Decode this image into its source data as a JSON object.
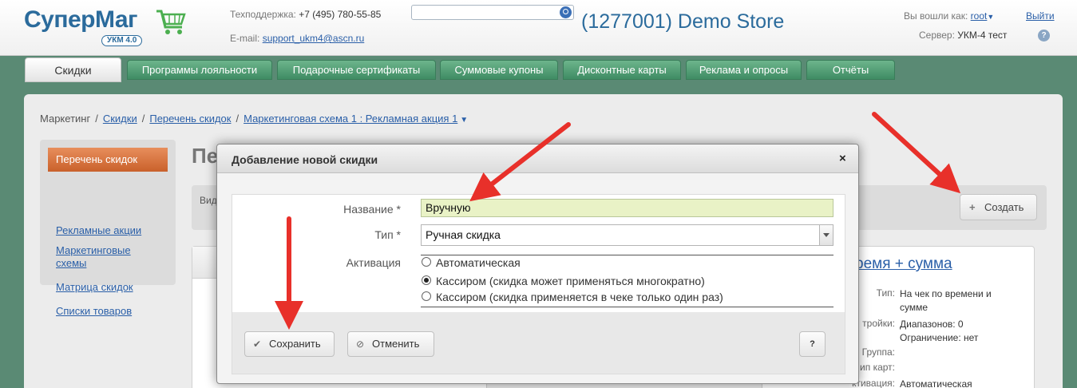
{
  "header": {
    "logo_text": "СуперМаг",
    "logo_badge": "УКМ 4.0",
    "support_label": "Техподдержка:",
    "support_phone": "+7 (495) 780-55-85",
    "email_label": "E-mail:",
    "email": "support_ukm4@ascn.ru",
    "search_placeholder": "",
    "store": "(1277001) Demo Store",
    "login_label": "Вы вошли как:",
    "login_user": "root",
    "logout": "Выйти",
    "server_label": "Сервер:",
    "server_value": "УКМ-4 тест",
    "help": "?"
  },
  "tabs": [
    {
      "label": "Скидки",
      "active": true
    },
    {
      "label": "Программы лояльности"
    },
    {
      "label": "Подарочные сертификаты"
    },
    {
      "label": "Суммовые купоны"
    },
    {
      "label": "Дисконтные карты"
    },
    {
      "label": "Реклама и опросы"
    },
    {
      "label": "Отчёты"
    }
  ],
  "breadcrumb": {
    "root": "Маркетинг",
    "items": [
      "Скидки",
      "Перечень скидок",
      "Маркетинговая схема 1 : Рекламная акция 1"
    ],
    "sep": "/"
  },
  "sidebar": {
    "active": "Перечень скидок",
    "items": [
      "Рекламные акции",
      "Маркетинговые схемы",
      "Матрица скидок",
      "Списки товаров"
    ]
  },
  "page": {
    "title": "Пе",
    "view_label": "Вид",
    "create_button": "Создать"
  },
  "card_right": {
    "title": "ремя + сумма",
    "rows": [
      {
        "k": "Тип:",
        "v": "На чек по времени и сумме"
      },
      {
        "k": "тройки:",
        "v": "Диапазонов: 0"
      },
      {
        "k": "",
        "v": "Ограничение: нет"
      },
      {
        "k": "Группа:",
        "v": ""
      },
      {
        "k": "ип карт:",
        "v": ""
      },
      {
        "k": "ктивация:",
        "v": "Автоматическая"
      }
    ]
  },
  "modal": {
    "title": "Добавление новой скидки",
    "close": "×",
    "name_label": "Название *",
    "name_value": "Вручную",
    "type_label": "Тип *",
    "type_value": "Ручная скидка",
    "activation_label": "Активация",
    "radios": [
      {
        "label": "Автоматическая",
        "checked": false
      },
      {
        "label": "Кассиром (скидка может применяться многократно)",
        "checked": true
      },
      {
        "label": "Кассиром (скидка применяется в чеке только один раз)",
        "checked": false
      }
    ],
    "save": "Сохранить",
    "cancel": "Отменить",
    "help": "?"
  },
  "colors": {
    "accent_arrow": "#e8302a",
    "brand_blue": "#2b6b9c",
    "tab_green": "#4f9a72",
    "sidebar_active": "#d9733f",
    "name_field_bg": "#e9f2c6"
  }
}
